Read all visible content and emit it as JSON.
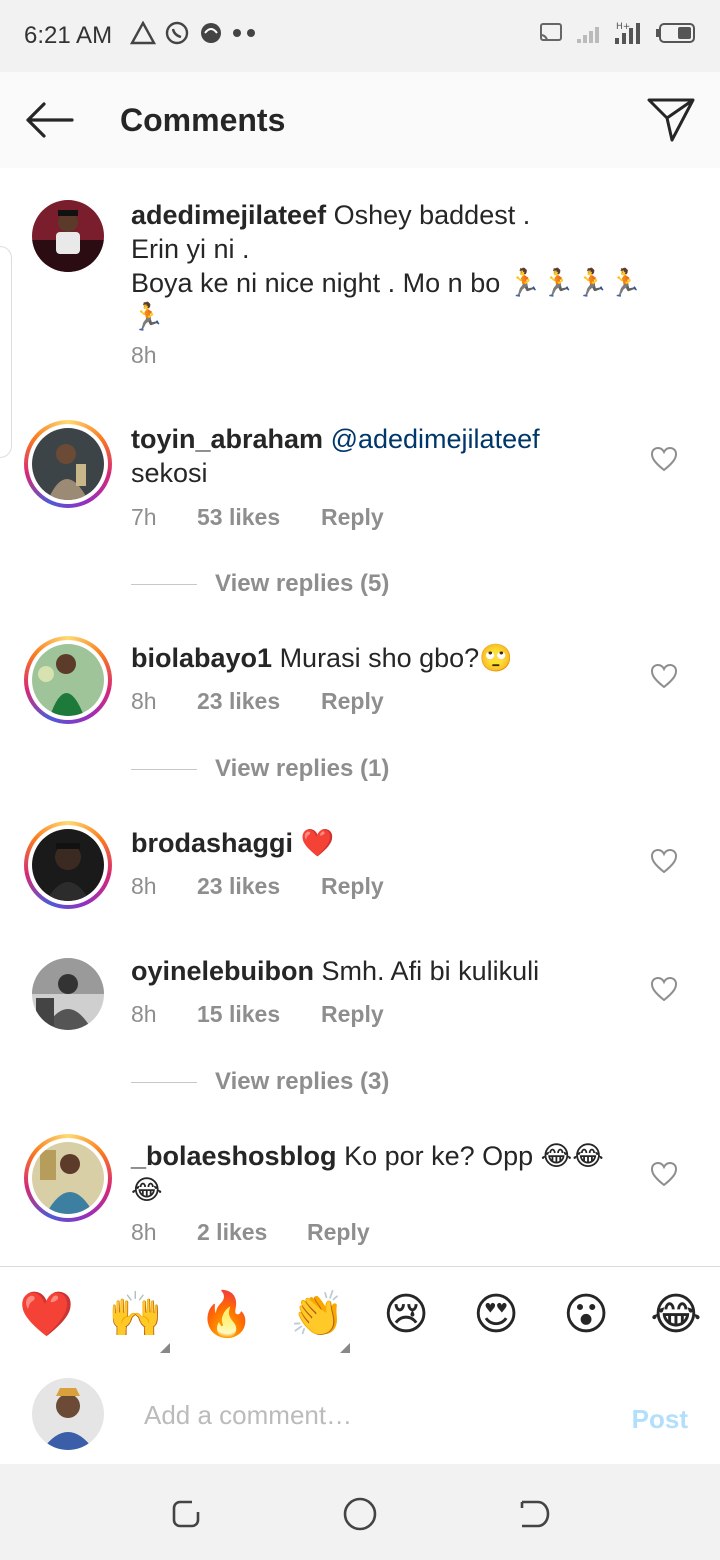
{
  "status_bar": {
    "time": "6:21 AM"
  },
  "header": {
    "title": "Comments"
  },
  "caption": {
    "username": "adedimejilateef",
    "text_line1": "Oshey baddest .",
    "text_line2": "Erin yi ni .",
    "text_line3": "Boya ke ni nice night . Mo n bo 🏃🏃🏃🏃",
    "text_line4": "🏃",
    "time": "8h"
  },
  "comments": [
    {
      "username": "toyin_abraham",
      "mention": "@adedimejilateef",
      "text": "sekosi",
      "time": "7h",
      "likes": "53 likes",
      "reply": "Reply",
      "view_replies": "View replies (5)"
    },
    {
      "username": "biolabayo1",
      "text": "Murasi sho gbo?🙄",
      "time": "8h",
      "likes": "23 likes",
      "reply": "Reply",
      "view_replies": "View replies (1)"
    },
    {
      "username": "brodashaggi",
      "text": "❤️",
      "time": "8h",
      "likes": "23 likes",
      "reply": "Reply"
    },
    {
      "username": "oyinelebuibon",
      "text": "Smh. Afi bi kulikuli",
      "time": "8h",
      "likes": "15 likes",
      "reply": "Reply",
      "view_replies": "View replies (3)"
    },
    {
      "username": "_bolaeshosblog",
      "text": "Ko por ke? Opp 😂😂",
      "text2": "😂",
      "time": "8h",
      "likes": "2 likes",
      "reply": "Reply"
    }
  ],
  "emoji_bar": [
    "❤️",
    "🙌",
    "🔥",
    "👏",
    "😢",
    "😍",
    "😮",
    "😂"
  ],
  "input": {
    "placeholder": "Add a comment…",
    "post_label": "Post"
  },
  "colors": {
    "mention": "#00376b",
    "meta": "#8e8e8e",
    "post": "#b2dffc"
  }
}
